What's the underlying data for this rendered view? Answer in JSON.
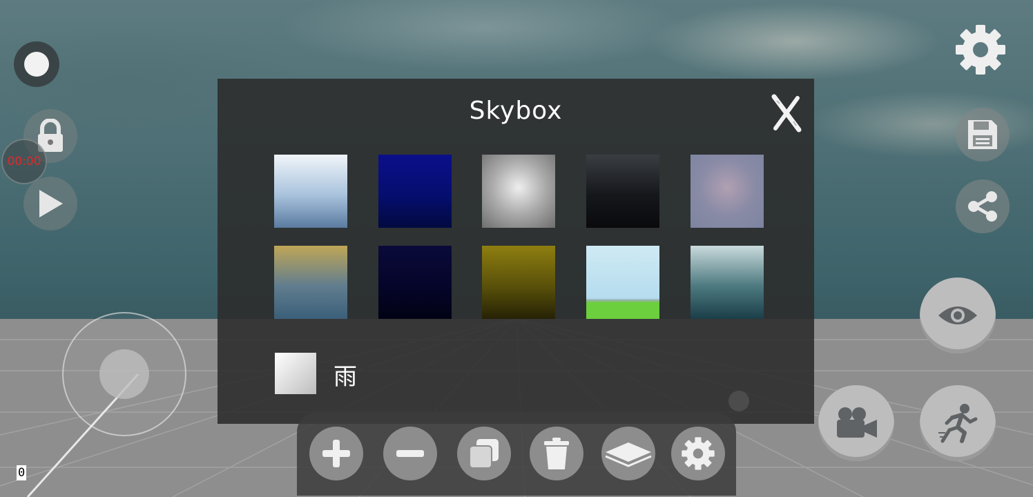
{
  "panel": {
    "title": "Skybox",
    "close_icon": "close-x-icon",
    "skyboxes": [
      {
        "name": "skybox-cloudy-day",
        "colors": [
          "#f0f4f8",
          "#a9c3dd",
          "#5a7ba0"
        ]
      },
      {
        "name": "skybox-deep-blue",
        "colors": [
          "#0b0f8a",
          "#050e6f",
          "#020a40"
        ]
      },
      {
        "name": "skybox-gray-storm",
        "colors": [
          "#eeeeee",
          "#a9a9a9",
          "#6e6e6e"
        ]
      },
      {
        "name": "skybox-dark-clouds",
        "colors": [
          "#3a3d42",
          "#15171b",
          "#0a0a0d"
        ]
      },
      {
        "name": "skybox-hazy-purple",
        "colors": [
          "#b1a0b2",
          "#8a8ba6",
          "#7c84a0"
        ]
      },
      {
        "name": "skybox-gold-teal",
        "colors": [
          "#c0a657",
          "#607d8e",
          "#3b5f7a"
        ]
      },
      {
        "name": "skybox-night",
        "colors": [
          "#0a0a3a",
          "#05052a",
          "#020214"
        ]
      },
      {
        "name": "skybox-olive-storm",
        "colors": [
          "#8e7e10",
          "#5a510a",
          "#252205"
        ]
      },
      {
        "name": "skybox-meadow",
        "colors": [
          "#cfeaf4",
          "#b5dcee",
          "#6ccf3d"
        ]
      },
      {
        "name": "skybox-ocean-light",
        "colors": [
          "#c9dadc",
          "#4d7a80",
          "#1b3e48"
        ]
      }
    ],
    "rain_label": "雨"
  },
  "hud": {
    "timer": "00:00",
    "counter": "0"
  },
  "toolbar": {
    "tools": [
      "add-icon",
      "remove-icon",
      "duplicate-icon",
      "trash-icon",
      "layers-icon",
      "settings-icon"
    ]
  },
  "colors": {
    "panel_bg": "#2b2b2b",
    "timer_text": "#e0292b",
    "button_light": "#bdbdbd",
    "button_dark": "#8d8d8d"
  }
}
